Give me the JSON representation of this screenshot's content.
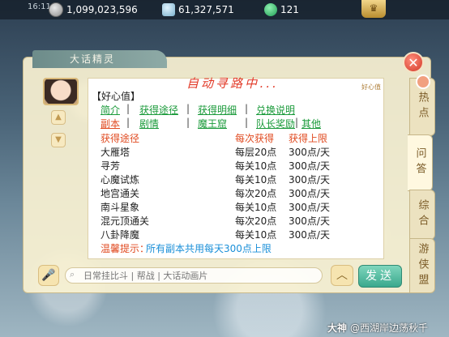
{
  "topbar": {
    "time": "16:11:0",
    "gold": "1,099,023,596",
    "silver": "61,327,571",
    "jade": "121",
    "crown_label": "♛"
  },
  "panel": {
    "title": "大话精灵",
    "close_label": "✕",
    "heading": "自动寻路中...",
    "corner_tag": "好心值"
  },
  "right_tabs": [
    "热点",
    "问答",
    "综合",
    "游侠盟"
  ],
  "content": {
    "section_label": "【好心值】",
    "links_row1": [
      "简介",
      "获得途径",
      "获得明细",
      "兑换说明"
    ],
    "links_row2": [
      "副本",
      "剧情",
      "魔王窟",
      "队长奖励",
      "其他"
    ],
    "table_headers": [
      "获得途径",
      "每次获得",
      "获得上限"
    ],
    "rows": [
      [
        "大雁塔",
        "每层20点",
        "300点/天"
      ],
      [
        "寻芳",
        "每关10点",
        "300点/天"
      ],
      [
        "心魔试炼",
        "每关10点",
        "300点/天"
      ],
      [
        "地宫通关",
        "每次20点",
        "300点/天"
      ],
      [
        "南斗星象",
        "每关10点",
        "300点/天"
      ],
      [
        "混元顶通关",
        "每次20点",
        "300点/天"
      ],
      [
        "八卦降魔",
        "每关10点",
        "300点/天"
      ]
    ],
    "tip_label": "温馨提示：",
    "tip_text": "所有副本共用每天300点上限"
  },
  "chat": {
    "placeholder": "日常挂比斗 | 帮战 | 大话动画片",
    "send_label": "发送",
    "up_label": "︿",
    "mic_label": "🎤"
  },
  "watermark": {
    "brand": "大神",
    "author": "@西湖岸边荡秋千"
  },
  "colors": {
    "link_green": "#1a9a3a",
    "accent_red": "#e04a20",
    "tip_blue": "#1a8fd8",
    "send_green": "#3aa88d"
  }
}
